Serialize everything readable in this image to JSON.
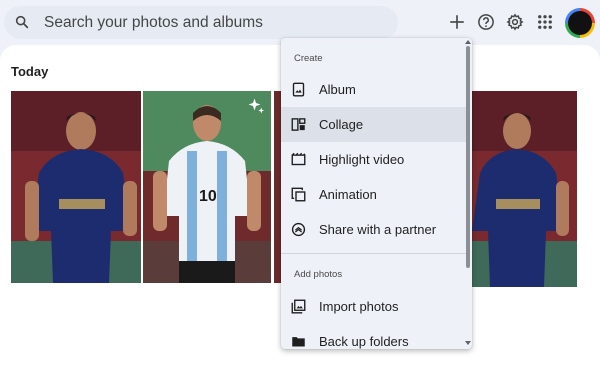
{
  "search": {
    "placeholder": "Search your photos and albums"
  },
  "toolbar": {
    "icons": [
      "plus-icon",
      "help-icon",
      "gear-icon",
      "apps-grid-icon",
      "account-avatar"
    ]
  },
  "section": {
    "title": "Today"
  },
  "menu": {
    "create_header": "Create",
    "create_items": [
      {
        "label": "Album",
        "icon": "album-icon"
      },
      {
        "label": "Collage",
        "icon": "collage-icon"
      },
      {
        "label": "Highlight video",
        "icon": "highlight-video-icon"
      },
      {
        "label": "Animation",
        "icon": "animation-icon"
      },
      {
        "label": "Share with a partner",
        "icon": "share-partner-icon"
      }
    ],
    "add_header": "Add photos",
    "add_items": [
      {
        "label": "Import photos",
        "icon": "import-photos-icon"
      },
      {
        "label": "Back up folders",
        "icon": "backup-folders-icon"
      }
    ],
    "highlighted_item": "Collage"
  },
  "colors": {
    "accent": "#0b57d0",
    "menu_bg": "#eef1f8",
    "menu_hover": "#dce0e8",
    "page_bg": "#eef2f8"
  }
}
